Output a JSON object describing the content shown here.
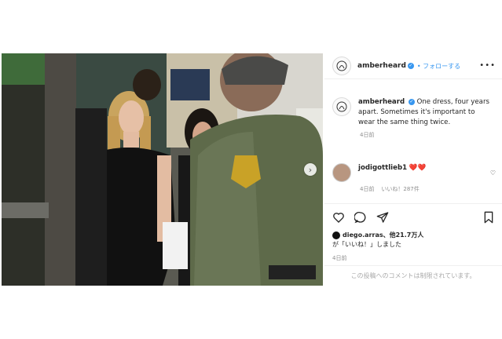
{
  "post": {
    "username": "amberheard",
    "follow_label": "• フォローする",
    "more_icon": "more-dots-icon",
    "verified_icon": "verified-badge-icon",
    "carousel_next_icon": "chevron-right-icon",
    "caption_text": "One dress, four years apart. Sometimes it's important to wear the same thing twice.",
    "caption_time": "4日前",
    "comment": {
      "username": "jodigottlieb1",
      "text": "❤️❤️",
      "time": "4日前",
      "likes": "いいね！287件"
    },
    "liked_by_user": "diego.arras",
    "liked_by_rest": "、他21.7万人",
    "liked_by_suffix": "が「いいね！」しました",
    "post_time": "4日前",
    "comments_disabled": "この投稿へのコメントは制限されています。"
  },
  "colors": {
    "link_blue": "#3897f0",
    "muted_gray": "#8e8e8e",
    "border": "#efefef"
  }
}
